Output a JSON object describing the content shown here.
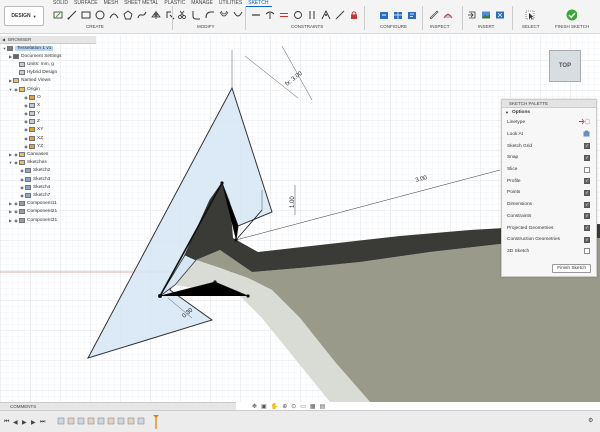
{
  "toolbar": {
    "workspace": "DESIGN",
    "tabs": [
      "SOLID",
      "SURFACE",
      "MESH",
      "SHEET METAL",
      "PLASTIC",
      "MANAGE",
      "UTILITIES",
      "SKETCH"
    ],
    "groups": {
      "create": "CREATE",
      "modify": "MODIFY",
      "constraints": "CONSTRAINTS",
      "configure": "CONFIGURE",
      "inspect": "INSPECT",
      "insert": "INSERT",
      "select": "SELECT",
      "finish": "FINISH SKETCH"
    },
    "accent": "#0a64c8",
    "finish_color": "#3aa83a"
  },
  "browser": {
    "title": "BROWSER",
    "items": [
      {
        "label": "Tesselation 1 v1",
        "icon": "document-icon",
        "selected": true
      },
      {
        "label": "Document Settings",
        "icon": "gear-icon"
      },
      {
        "label": "Units: mm, g",
        "icon": "units-icon"
      },
      {
        "label": "Hybrid Design",
        "icon": "design-icon"
      },
      {
        "label": "Named Views",
        "icon": "folder-icon"
      },
      {
        "label": "Origin",
        "icon": "folder-icon"
      },
      {
        "label": "O",
        "icon": "origin-point-icon"
      },
      {
        "label": "X",
        "icon": "axis-icon"
      },
      {
        "label": "Y",
        "icon": "axis-icon"
      },
      {
        "label": "Z",
        "icon": "axis-icon"
      },
      {
        "label": "XY",
        "icon": "plane-icon"
      },
      {
        "label": "XZ",
        "icon": "plane-icon"
      },
      {
        "label": "YZ",
        "icon": "plane-icon"
      },
      {
        "label": "Canvases",
        "icon": "folder-icon"
      },
      {
        "label": "Sketches",
        "icon": "folder-icon"
      },
      {
        "label": "Sketch2",
        "icon": "sketch-icon"
      },
      {
        "label": "Sketch3",
        "icon": "sketch-icon"
      },
      {
        "label": "Sketch4",
        "icon": "sketch-icon"
      },
      {
        "label": "Sketch7",
        "icon": "sketch-icon"
      },
      {
        "label": "Component11",
        "icon": "component-icon"
      },
      {
        "label": "Component21",
        "icon": "component-icon"
      },
      {
        "label": "Component31",
        "icon": "component-icon"
      }
    ]
  },
  "viewcube": {
    "label": "TOP"
  },
  "palette": {
    "title": "SKETCH PALETTE",
    "section": "Options",
    "rows": [
      {
        "label": "Linetype",
        "control": "linetype"
      },
      {
        "label": "Look At",
        "control": "lookat"
      },
      {
        "label": "Sketch Grid",
        "checked": true
      },
      {
        "label": "Snap",
        "checked": true
      },
      {
        "label": "Slice",
        "checked": false
      },
      {
        "label": "Profile",
        "checked": true
      },
      {
        "label": "Points",
        "checked": true
      },
      {
        "label": "Dimensions",
        "checked": true
      },
      {
        "label": "Constraints",
        "checked": true
      },
      {
        "label": "Projected Geometries",
        "checked": true
      },
      {
        "label": "Construction Geometries",
        "checked": true
      },
      {
        "label": "3D Sketch",
        "checked": false
      }
    ],
    "finish_label": "Finish Sketch"
  },
  "dimensions": {
    "d1": "fx: 3.00",
    "d2": "3.00",
    "d3": "1.00",
    "d4": "0.30"
  },
  "bottom": {
    "comments": "COMMENTS"
  }
}
